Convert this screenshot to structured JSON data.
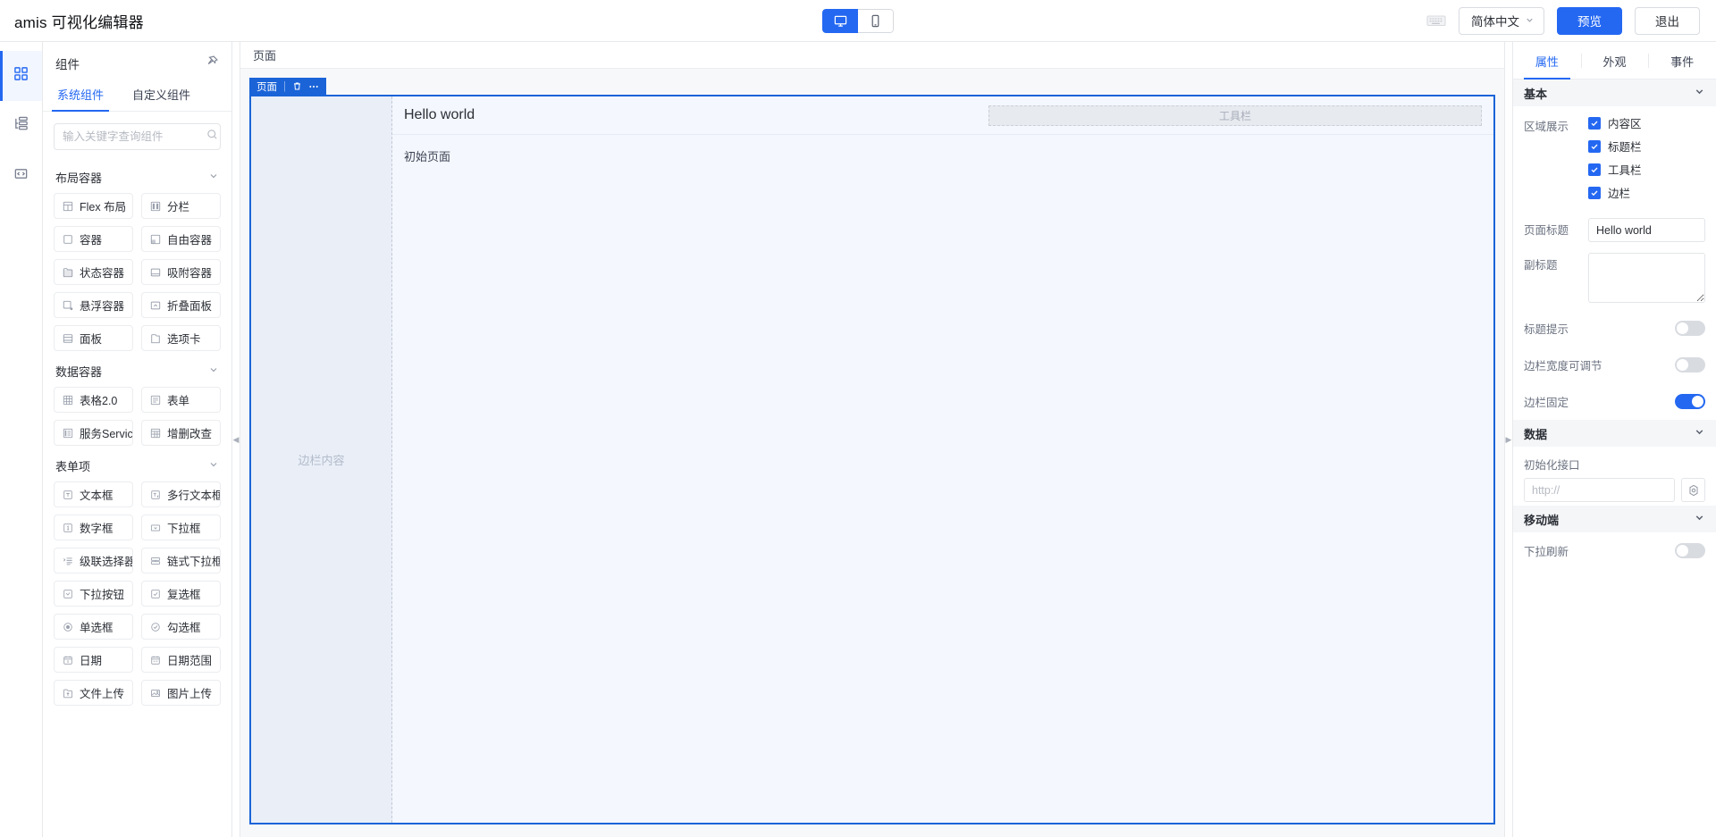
{
  "topbar": {
    "brand": "amis 可视化编辑器",
    "device_desktop_icon": "desktop-icon",
    "device_mobile_icon": "mobile-icon",
    "keyboard_icon": "keyboard-icon",
    "language": "简体中文",
    "preview_label": "预览",
    "exit_label": "退出",
    "accent_color": "#2468f2"
  },
  "rail": {
    "items": [
      {
        "icon": "grid-components-icon",
        "name": "components"
      },
      {
        "icon": "outline-tree-icon",
        "name": "outline"
      },
      {
        "icon": "code-icon",
        "name": "code"
      }
    ]
  },
  "panel": {
    "title": "组件",
    "pin_icon": "pin-icon",
    "tabs": [
      {
        "label": "系统组件",
        "active": true
      },
      {
        "label": "自定义组件",
        "active": false
      }
    ],
    "search": {
      "placeholder": "输入关键字查询组件",
      "value": "",
      "icon": "search-icon"
    },
    "groups": [
      {
        "title": "布局容器",
        "chevron": "chevron-down-icon",
        "items": [
          {
            "label": "Flex 布局",
            "icon": "layout-flex-icon"
          },
          {
            "label": "分栏",
            "icon": "columns-icon"
          },
          {
            "label": "容器",
            "icon": "square-icon"
          },
          {
            "label": "自由容器",
            "icon": "free-container-icon"
          },
          {
            "label": "状态容器",
            "icon": "state-container-icon"
          },
          {
            "label": "吸附容器",
            "icon": "sticky-container-icon"
          },
          {
            "label": "悬浮容器",
            "icon": "float-container-icon"
          },
          {
            "label": "折叠面板",
            "icon": "collapse-panel-icon"
          },
          {
            "label": "面板",
            "icon": "panel-icon"
          },
          {
            "label": "选项卡",
            "icon": "tabs-icon"
          }
        ]
      },
      {
        "title": "数据容器",
        "chevron": "chevron-down-icon",
        "items": [
          {
            "label": "表格2.0",
            "icon": "table-icon"
          },
          {
            "label": "表单",
            "icon": "form-icon"
          },
          {
            "label": "服务Service",
            "icon": "service-icon"
          },
          {
            "label": "增删改查",
            "icon": "crud-icon"
          }
        ]
      },
      {
        "title": "表单项",
        "chevron": "chevron-down-icon",
        "items": [
          {
            "label": "文本框",
            "icon": "text-input-icon"
          },
          {
            "label": "多行文本框",
            "icon": "textarea-icon"
          },
          {
            "label": "数字框",
            "icon": "number-input-icon"
          },
          {
            "label": "下拉框",
            "icon": "select-icon"
          },
          {
            "label": "级联选择器",
            "icon": "cascader-icon"
          },
          {
            "label": "链式下拉框",
            "icon": "chained-select-icon"
          },
          {
            "label": "下拉按钮",
            "icon": "dropdown-button-icon"
          },
          {
            "label": "复选框",
            "icon": "checkbox-icon"
          },
          {
            "label": "单选框",
            "icon": "radio-icon"
          },
          {
            "label": "勾选框",
            "icon": "check-icon"
          },
          {
            "label": "日期",
            "icon": "calendar-icon"
          },
          {
            "label": "日期范围",
            "icon": "calendar-range-icon"
          },
          {
            "label": "文件上传",
            "icon": "file-upload-icon"
          },
          {
            "label": "图片上传",
            "icon": "image-upload-icon"
          }
        ]
      }
    ]
  },
  "canvas": {
    "breadcrumb": "页面",
    "badge": {
      "label": "页面",
      "delete_icon": "trash-icon",
      "more_icon": "ellipsis-icon"
    },
    "aside_placeholder": "边栏内容",
    "page_title": "Hello world",
    "toolbar_placeholder": "工具栏",
    "content_text": "初始页面",
    "selection_color": "#1b64d8"
  },
  "props": {
    "tabs": [
      {
        "label": "属性",
        "active": true
      },
      {
        "label": "外观",
        "active": false
      },
      {
        "label": "事件",
        "active": false
      }
    ],
    "sections": [
      {
        "title": "基本",
        "chevron": "chevron-down-icon",
        "region_field_label": "区域展示",
        "region_checkboxes": [
          {
            "label": "内容区",
            "checked": true
          },
          {
            "label": "标题栏",
            "checked": true
          },
          {
            "label": "工具栏",
            "checked": true
          },
          {
            "label": "边栏",
            "checked": true
          }
        ],
        "page_title_label": "页面标题",
        "page_title_value": "Hello world",
        "subtitle_label": "副标题",
        "subtitle_value": "",
        "switches": [
          {
            "label": "标题提示",
            "on": false
          },
          {
            "label": "边栏宽度可调节",
            "on": false
          },
          {
            "label": "边栏固定",
            "on": true
          }
        ]
      },
      {
        "title": "数据",
        "chevron": "chevron-down-icon",
        "api_label": "初始化接口",
        "api_placeholder": "http://",
        "api_value": "",
        "api_settings_icon": "settings-icon"
      },
      {
        "title": "移动端",
        "chevron": "chevron-down-icon",
        "switches": [
          {
            "label": "下拉刷新",
            "on": false
          }
        ]
      }
    ]
  }
}
